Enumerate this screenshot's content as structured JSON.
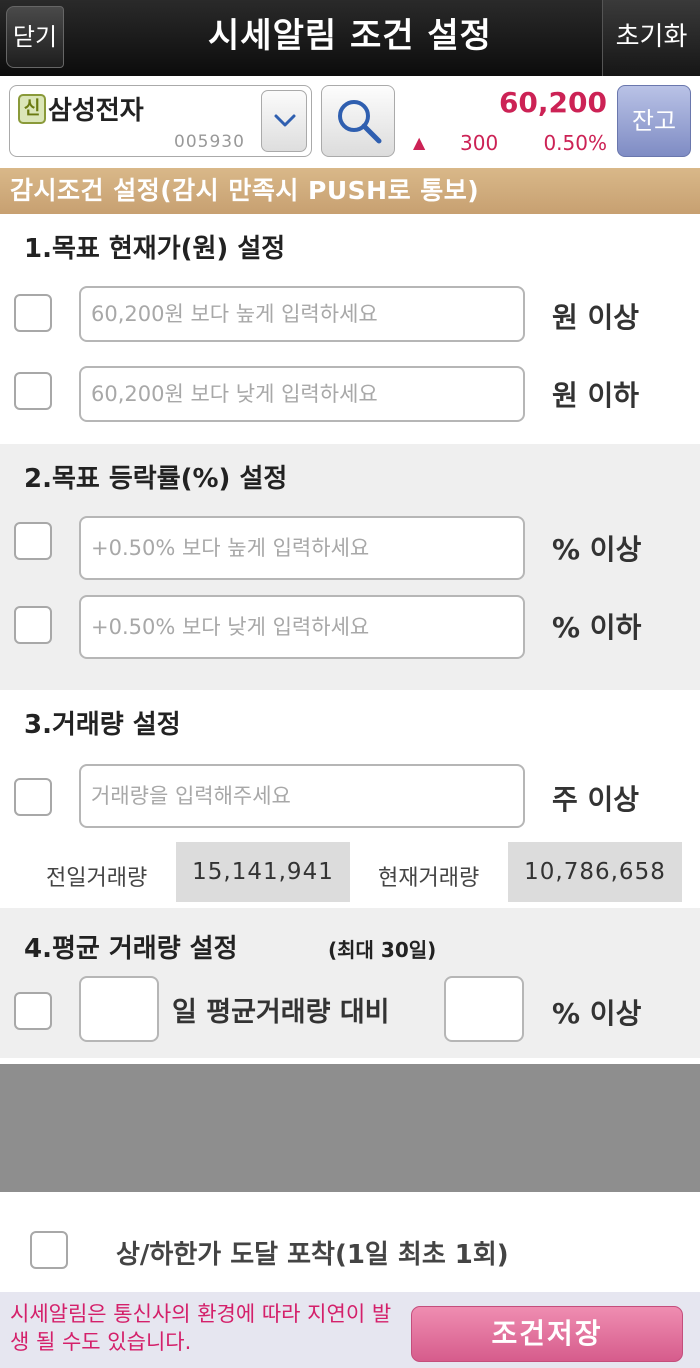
{
  "header": {
    "title": "시세알림 조건 설정",
    "close_label": "닫기",
    "reset_label": "초기화"
  },
  "stock": {
    "badge": "신",
    "name": "삼성전자",
    "code": "005930",
    "price": "60,200",
    "change_arrow": "▲",
    "change_amount": "300",
    "change_rate": "0.50%",
    "balance_label": "잔고"
  },
  "banner": "감시조건 설정(감시 만족시 PUSH로 통보)",
  "section1": {
    "title": "1.목표 현재가(원) 설정",
    "above_placeholder": "60,200원 보다 높게 입력하세요",
    "above_unit": "원 이상",
    "below_placeholder": "60,200원 보다 낮게 입력하세요",
    "below_unit": "원 이하"
  },
  "section2": {
    "title": "2.목표 등락률(%) 설정",
    "above_placeholder": "+0.50% 보다 높게 입력하세요",
    "above_unit": "% 이상",
    "below_placeholder": "+0.50% 보다 낮게 입력하세요",
    "below_unit": "% 이하"
  },
  "section3": {
    "title": "3.거래량 설정",
    "placeholder": "거래량을 입력해주세요",
    "unit": "주 이상",
    "prev_label": "전일거래량",
    "prev_value": "15,141,941",
    "curr_label": "현재거래량",
    "curr_value": "10,786,658"
  },
  "section4": {
    "title": "4.평균 거래량 설정",
    "note": "(최대 30일)",
    "mid_text": "일 평균거래량 대비",
    "unit": "% 이상"
  },
  "limit": {
    "label": "상/하한가 도달 포착(1일 최초 1회)"
  },
  "footer": {
    "note": "시세알림은 통신사의 환경에 따라 지연이 발생 될 수도 있습니다.",
    "save_label": "조건저장"
  },
  "colors": {
    "price_up": "#cc2255",
    "banner": "#cfa97a",
    "balance_button": "#8f9bd0",
    "save_button": "#e0709c"
  }
}
